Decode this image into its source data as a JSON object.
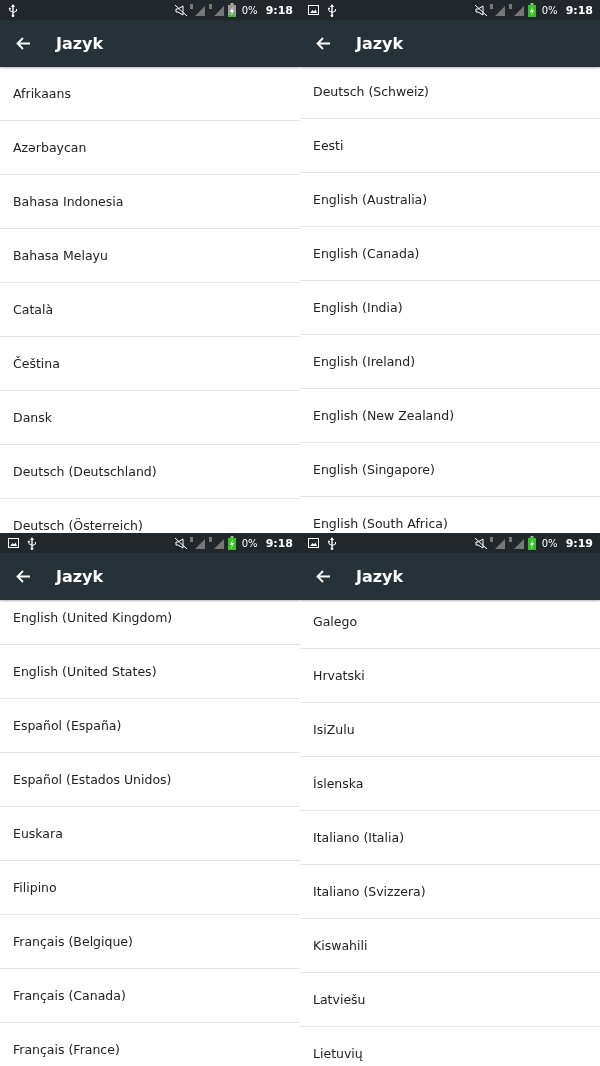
{
  "screens": [
    {
      "status_bar": {
        "notifications": [
          {
            "kind": "usb"
          }
        ],
        "percent": "0%",
        "time": "9:18"
      },
      "title": "Jazyk",
      "items": [
        "Afrikaans",
        "Azərbaycan",
        "Bahasa Indonesia",
        "Bahasa Melayu",
        "Català",
        "Čeština",
        "Dansk",
        "Deutsch (Deutschland)",
        "Deutsch (Österreich)"
      ]
    },
    {
      "status_bar": {
        "notifications": [
          {
            "kind": "image"
          },
          {
            "kind": "usb"
          }
        ],
        "percent": "0%",
        "time": "9:18"
      },
      "title": "Jazyk",
      "items": [
        "Deutsch (Schweiz)",
        "Eesti",
        "English (Australia)",
        "English (Canada)",
        "English (India)",
        "English (Ireland)",
        "English (New Zealand)",
        "English (Singapore)",
        "English (South Africa)"
      ]
    },
    {
      "status_bar": {
        "notifications": [
          {
            "kind": "image"
          },
          {
            "kind": "usb"
          }
        ],
        "percent": "0%",
        "time": "9:18"
      },
      "title": "Jazyk",
      "items": [
        "English (United Kingdom)",
        "English (United States)",
        "Español (España)",
        "Español (Estados Unidos)",
        "Euskara",
        "Filipino",
        "Français (Belgique)",
        "Français (Canada)",
        "Français (France)"
      ]
    },
    {
      "status_bar": {
        "notifications": [
          {
            "kind": "image"
          },
          {
            "kind": "usb"
          }
        ],
        "percent": "0%",
        "time": "9:19"
      },
      "title": "Jazyk",
      "items": [
        "Galego",
        "Hrvatski",
        "IsiZulu",
        "Íslenska",
        "Italiano (Italia)",
        "Italiano (Svizzera)",
        "Kiswahili",
        "Latviešu",
        "Lietuvių"
      ]
    }
  ]
}
